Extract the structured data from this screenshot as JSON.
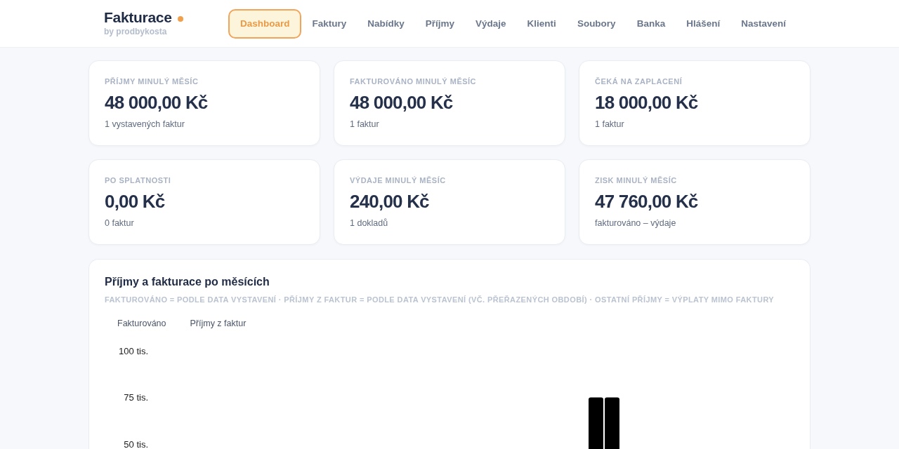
{
  "header": {
    "logo": {
      "title": "Fakturace",
      "subtitle": "by prodbykosta"
    },
    "nav": [
      {
        "label": "Dashboard",
        "selected": true
      },
      {
        "label": "Faktury",
        "selected": false
      },
      {
        "label": "Nabídky",
        "selected": false
      },
      {
        "label": "Příjmy",
        "selected": false
      },
      {
        "label": "Výdaje",
        "selected": false
      },
      {
        "label": "Klienti",
        "selected": false
      },
      {
        "label": "Soubory",
        "selected": false
      },
      {
        "label": "Banka",
        "selected": false
      },
      {
        "label": "Hlášení",
        "selected": false
      },
      {
        "label": "Nastavení",
        "selected": false
      }
    ]
  },
  "stats": [
    {
      "label": "PŘÍJMY MINULÝ MĚSÍC",
      "value": "48 000,00 Kč",
      "note": "1 vystavených faktur"
    },
    {
      "label": "FAKTUROVÁNO MINULÝ MĚSÍC",
      "value": "48 000,00 Kč",
      "note": "1 faktur"
    },
    {
      "label": "ČEKÁ NA ZAPLACENÍ",
      "value": "18 000,00 Kč",
      "note": "1 faktur"
    },
    {
      "label": "PO SPLATNOSTI",
      "value": "0,00 Kč",
      "note": "0 faktur"
    },
    {
      "label": "VÝDAJE MINULÝ MĚSÍC",
      "value": "240,00 Kč",
      "note": "1 dokladů"
    },
    {
      "label": "ZISK MINULÝ MĚSÍC",
      "value": "47 760,00 Kč",
      "note": "fakturováno – výdaje"
    }
  ],
  "chart_panel": {
    "title": "Příjmy a fakturace po měsících",
    "subtitle": "FAKTUROVÁNO = PODLE DATA VYSTAVENÍ · PŘÍJMY Z FAKTUR = PODLE DATA VYSTAVENÍ (VČ. PŘEŘAZENÝCH OBDOBÍ) · OSTATNÍ PŘÍJMY = VÝPLATY MIMO FAKTURY",
    "legend": [
      "Fakturováno",
      "Příjmy z faktur"
    ],
    "y_axis_labels": [
      "100 tis.",
      "75 tis.",
      "50 tis."
    ]
  }
}
